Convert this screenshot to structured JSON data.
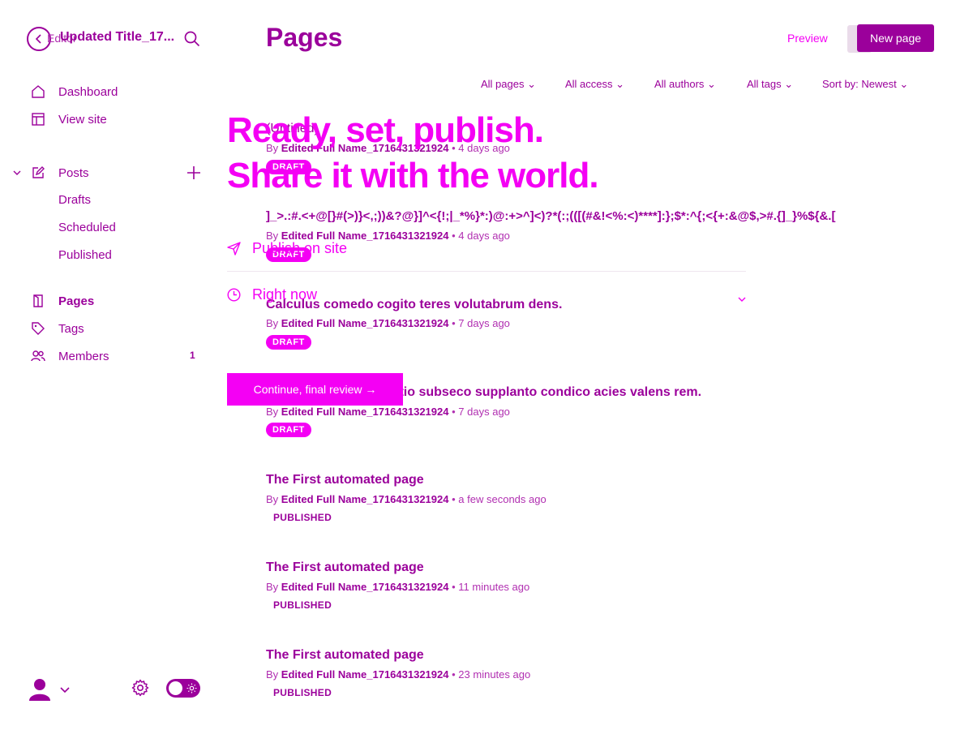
{
  "colors": {
    "primary": "#9b009b",
    "accent": "#f400f4"
  },
  "editor": {
    "back_label": "Editor",
    "title": "Updated Title_17...",
    "search_icon": "search-icon"
  },
  "sidebar": {
    "items": [
      {
        "label": "Dashboard",
        "icon": "house-icon"
      },
      {
        "label": "View site",
        "icon": "layout-icon"
      },
      {
        "label": "Posts",
        "icon": "pencil-square-icon"
      },
      {
        "label": "Drafts"
      },
      {
        "label": "Scheduled"
      },
      {
        "label": "Published"
      },
      {
        "label": "Pages",
        "icon": "page-icon"
      },
      {
        "label": "Tags",
        "icon": "tag-icon"
      },
      {
        "label": "Members",
        "icon": "members-icon",
        "count": "1"
      }
    ]
  },
  "header": {
    "title": "Pages",
    "preview_label": "Preview",
    "new_page_label": "New page"
  },
  "filters": {
    "pages": "All pages",
    "access": "All access",
    "authors": "All authors",
    "tags": "All tags",
    "sort": "Sort by: Newest"
  },
  "publish_overlay": {
    "headline_line1": "Ready, set, publish.",
    "headline_line2": "Share it with the world.",
    "publish_on": "Publish on site",
    "when": "Right now",
    "continue_label": "Continue, final review →"
  },
  "pages": [
    {
      "title": "(Untitled)",
      "author": "Edited Full Name_1716431321924",
      "time": "4 days ago",
      "status": "DRAFT"
    },
    {
      "title": "]_>.:#.<+@[}#(>)}<,;))&?@}]^<{!;|_*%}*:)@:+>^]<)?*(:;(([(#&!<%:<)****]:};$*:^{;<{+:&@$,>#.{]_}%${&.[",
      "author": "Edited Full Name_1716431321924",
      "time": "4 days ago",
      "status": "DRAFT"
    },
    {
      "title": "Calculus comedo cogito teres volutabrum dens.",
      "author": "Edited Full Name_1716431321924",
      "time": "7 days ago",
      "status": "DRAFT"
    },
    {
      "title": "Demoror minima agnitio subseco supplanto condico acies valens rem.",
      "author": "Edited Full Name_1716431321924",
      "time": "7 days ago",
      "status": "DRAFT"
    },
    {
      "title": "The First automated page",
      "author": "Edited Full Name_1716431321924",
      "time": "a few seconds ago",
      "status": "PUBLISHED"
    },
    {
      "title": "The First automated page",
      "author": "Edited Full Name_1716431321924",
      "time": "11 minutes ago",
      "status": "PUBLISHED"
    },
    {
      "title": "The First automated page",
      "author": "Edited Full Name_1716431321924",
      "time": "23 minutes ago",
      "status": "PUBLISHED"
    }
  ],
  "common": {
    "by": "By",
    "dot": "•"
  }
}
